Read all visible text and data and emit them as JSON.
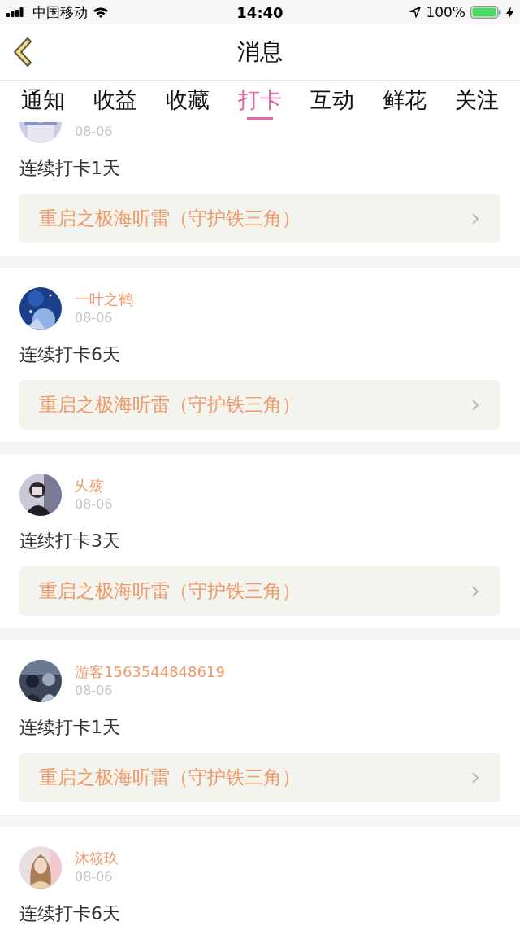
{
  "status_bar": {
    "carrier": "中国移动",
    "time": "14:40",
    "battery": "100%"
  },
  "nav": {
    "title": "消息"
  },
  "tabs": [
    {
      "label": "通知",
      "selected": false
    },
    {
      "label": "收益",
      "selected": false
    },
    {
      "label": "收藏",
      "selected": false
    },
    {
      "label": "打卡",
      "selected": true
    },
    {
      "label": "互动",
      "selected": false
    },
    {
      "label": "鲜花",
      "selected": false
    },
    {
      "label": "关注",
      "selected": false
    }
  ],
  "messages": [
    {
      "date": "08-06",
      "text": "连续打卡1天",
      "link": "重启之极海听雷（守护铁三角）"
    },
    {
      "name": "一叶之鹤",
      "date": "08-06",
      "text": "连续打卡6天",
      "link": "重启之极海听雷（守护铁三角）"
    },
    {
      "name": "乆殇",
      "date": "08-06",
      "text": "连续打卡3天",
      "link": "重启之极海听雷（守护铁三角）"
    },
    {
      "name": "游客1563544848619",
      "date": "08-06",
      "text": "连续打卡1天",
      "link": "重启之极海听雷（守护铁三角）"
    },
    {
      "name": "沐筱玖",
      "date": "08-06",
      "text": "连续打卡6天"
    }
  ]
}
